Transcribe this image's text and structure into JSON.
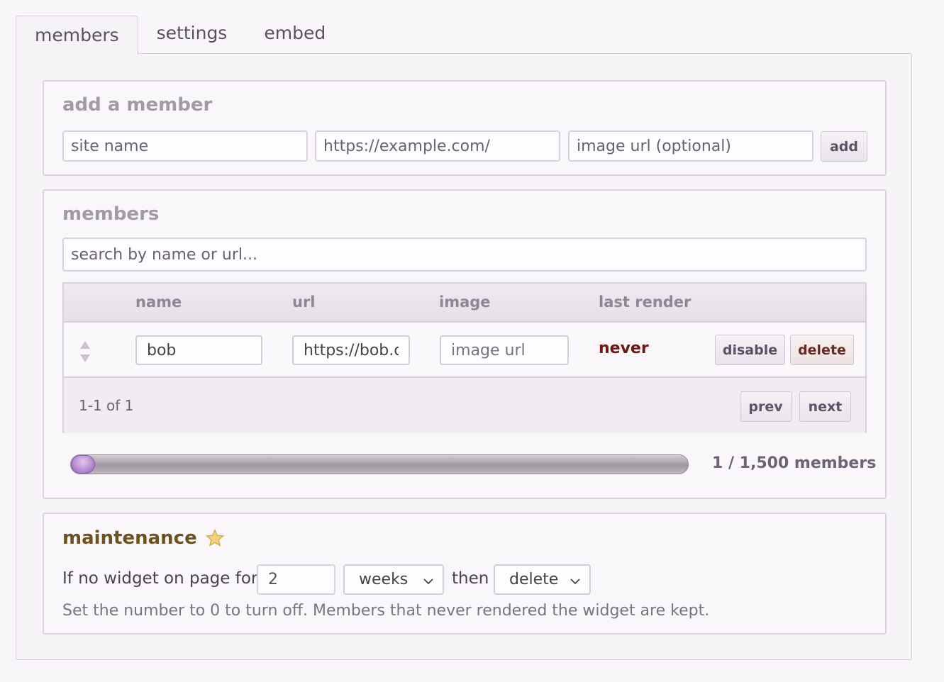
{
  "tabs": [
    {
      "label": "members",
      "active": true
    },
    {
      "label": "settings",
      "active": false
    },
    {
      "label": "embed",
      "active": false
    }
  ],
  "add_member": {
    "title": "add a member",
    "site_name_placeholder": "site name",
    "url_placeholder": "https://example.com/",
    "image_placeholder": "image url (optional)",
    "add_label": "add"
  },
  "members": {
    "title": "members",
    "search_placeholder": "search by name or url...",
    "columns": [
      "name",
      "url",
      "image",
      "last render"
    ],
    "rows": [
      {
        "name": "bob",
        "url": "https://bob.com/",
        "image_placeholder": "image url",
        "last_render": "never",
        "disable_label": "disable",
        "delete_label": "delete"
      }
    ],
    "pagination_text": "1-1 of 1",
    "prev_label": "prev",
    "next_label": "next",
    "count_text": "1 / 1,500 members",
    "usage_fraction": 0.000667
  },
  "maintenance": {
    "title": "maintenance",
    "prefix_text": "If no widget on page for",
    "number_value": "2",
    "unit_value": "weeks",
    "then_text": "then",
    "action_value": "delete",
    "help_text": "Set the number to 0 to turn off. Members that never rendered the widget are kept."
  },
  "colors": {
    "accent": "#b58ad0",
    "never": "#6b1a12",
    "maintenance_title": "#6b5220",
    "star": "#e6b84e"
  }
}
